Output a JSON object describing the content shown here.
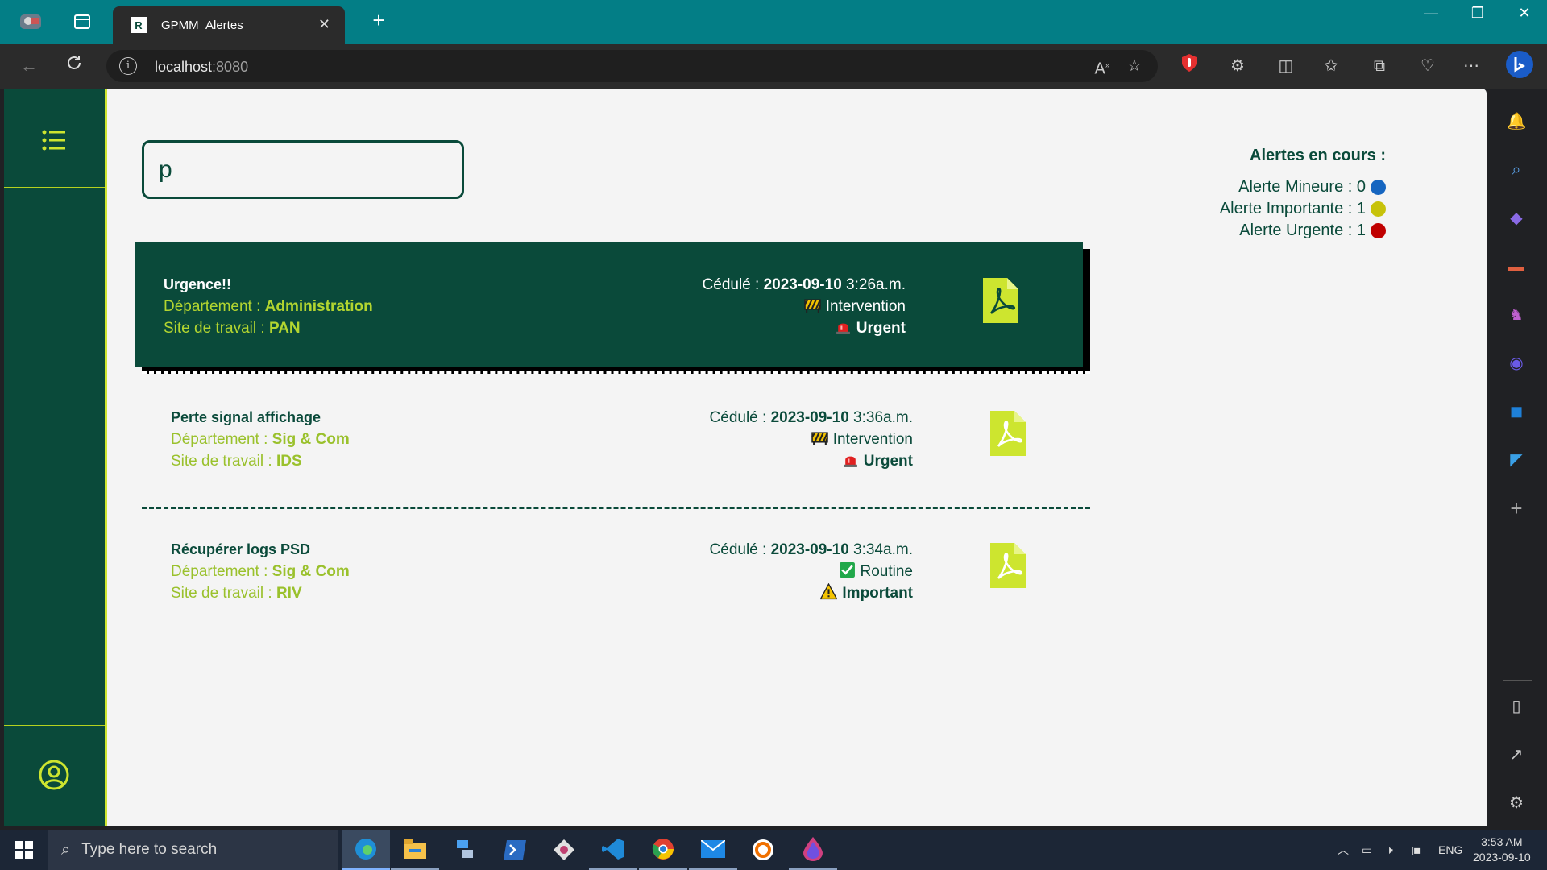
{
  "browser": {
    "tab_title": "GPMM_Alertes",
    "tab_favicon_letter": "R",
    "url_host": "localhost",
    "url_port": ":8080"
  },
  "search": {
    "value": "p"
  },
  "counts": {
    "title": "Alertes en cours :",
    "rows": [
      {
        "label": "Alerte Mineure : 0",
        "color": "#1565c0"
      },
      {
        "label": "Alerte Importante : 1",
        "color": "#c7c20a"
      },
      {
        "label": "Alerte Urgente : 1",
        "color": "#c00000"
      }
    ]
  },
  "labels": {
    "department": "Département : ",
    "site": "Site de travail : ",
    "scheduled": "Cédulé : "
  },
  "alerts": [
    {
      "title": "Urgence!!",
      "department": "Administration",
      "site": "PAN",
      "date": "2023-09-10",
      "time": " 3:26a.m.",
      "type": "Intervention",
      "type_icon": "barrier-icon",
      "priority": "Urgent",
      "priority_icon": "siren-icon"
    },
    {
      "title": "Perte signal affichage",
      "department": "Sig & Com",
      "site": "IDS",
      "date": "2023-09-10",
      "time": " 3:36a.m.",
      "type": "Intervention",
      "type_icon": "barrier-icon",
      "priority": "Urgent",
      "priority_icon": "siren-icon"
    },
    {
      "title": "Récupérer logs PSD",
      "department": "Sig & Com",
      "site": "RIV",
      "date": "2023-09-10",
      "time": " 3:34a.m.",
      "type": "Routine",
      "type_icon": "check-box-icon",
      "priority": "Important",
      "priority_icon": "warning-icon"
    }
  ],
  "taskbar": {
    "search_placeholder": "Type here to search",
    "lang": "ENG",
    "time": "3:53 AM",
    "date": "2023-09-10"
  },
  "colors": {
    "dark_green": "#0a4a3a",
    "lime": "#cde52f",
    "teal_titlebar": "#037e86"
  }
}
